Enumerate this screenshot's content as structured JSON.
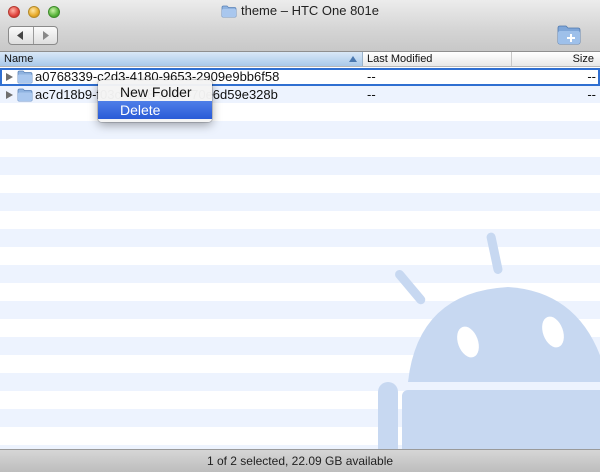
{
  "window": {
    "title": "theme – HTC One 801e"
  },
  "toolbar": {
    "back_icon": "chevron-left-icon",
    "forward_icon": "chevron-right-icon",
    "new_folder_icon": "new-folder-icon"
  },
  "columns": {
    "name": "Name",
    "modified": "Last Modified",
    "size": "Size"
  },
  "rows": [
    {
      "name": "a0768339-c2d3-4180-9653-2909e9bb6f58",
      "modified": "--",
      "size": "--",
      "selected": true
    },
    {
      "name": "ac7d18b9-f03c-4d28-a9c7-70e6d59e328b",
      "modified": "--",
      "size": "--",
      "selected": false
    }
  ],
  "context_menu": {
    "items": [
      "New Folder",
      "Delete"
    ],
    "highlighted": "Delete"
  },
  "status": {
    "text": "1 of 2 selected, 22.09 GB available"
  },
  "colors": {
    "accent": "#2f6fd1",
    "stripe": "#edf3fe",
    "watermark": "#c7d8f1"
  }
}
